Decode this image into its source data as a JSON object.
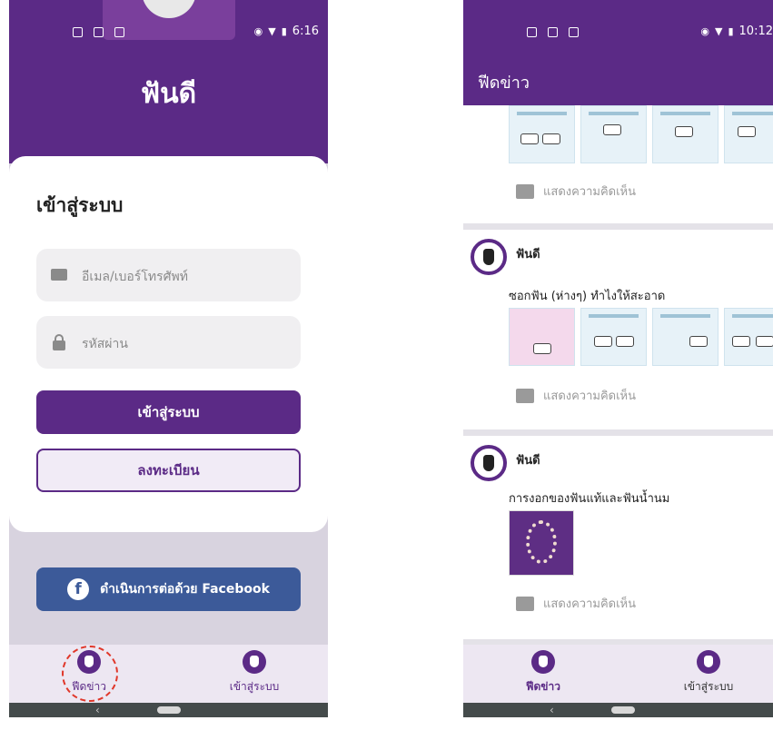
{
  "left": {
    "status_time": "6:16",
    "app_title": "ฟันดี",
    "login_heading": "เข้าสู่ระบบ",
    "email_placeholder": "อีเมล/เบอร์โทรศัพท์",
    "password_placeholder": "รหัสผ่าน",
    "login_button": "เข้าสู่ระบบ",
    "register_button": "ลงทะเบียน",
    "facebook_button": "ดำเนินการต่อด้วย Facebook",
    "nav_feed": "ฟีดข่าว",
    "nav_login": "เข้าสู่ระบบ"
  },
  "right": {
    "status_time": "10:12",
    "header_title": "ฟีดข่าว",
    "comment_label": "แสดงความคิดเห็น",
    "posts": [
      {
        "author": "ฟันดี",
        "text": "ซอกฟัน (ห่างๆ) ทำไงให้สะอาด"
      },
      {
        "author": "ฟันดี",
        "text": "การงอกของฟันแท้และฟันน้ำนม"
      }
    ],
    "nav_feed": "ฟีดข่าว",
    "nav_login": "เข้าสู่ระบบ"
  },
  "colors": {
    "brand_purple": "#5b2a86",
    "facebook_blue": "#3c5a99",
    "highlight_red": "#e0372a"
  },
  "icons": [
    "mail-icon",
    "lock-icon",
    "facebook-icon",
    "tooth-icon",
    "comment-icon"
  ]
}
